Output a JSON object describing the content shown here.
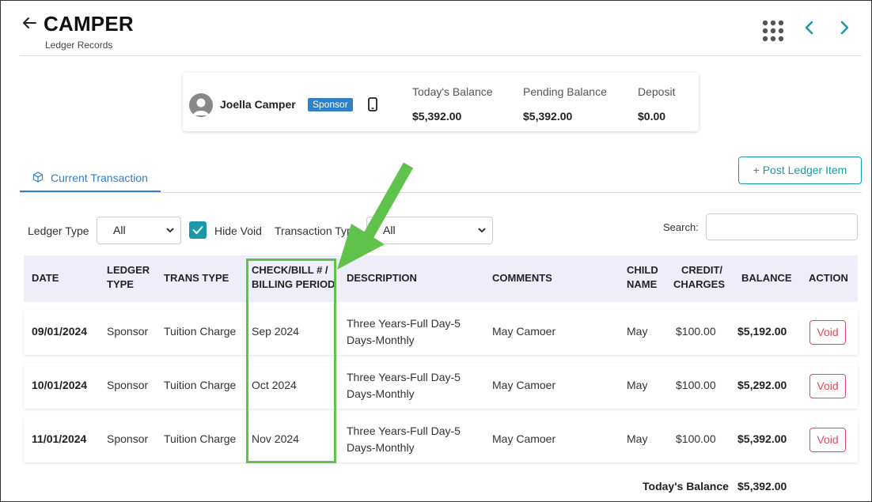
{
  "header": {
    "title": "CAMPER",
    "subtitle": "Ledger Records"
  },
  "summary": {
    "camper_name": "Joella Camper",
    "badge": "Sponsor",
    "todays_balance_label": "Today's Balance",
    "todays_balance_value": "$5,392.00",
    "pending_balance_label": "Pending Balance",
    "pending_balance_value": "$5,392.00",
    "deposit_label": "Deposit",
    "deposit_value": "$0.00"
  },
  "tabs": [
    {
      "label": "Current Transaction"
    }
  ],
  "post_button": "+ Post Ledger Item",
  "filters": {
    "ledger_type_label": "Ledger Type",
    "ledger_type_value": "All",
    "hide_void_label": "Hide Void",
    "hide_void_checked": true,
    "transaction_type_label": "Transaction Type",
    "transaction_type_value": "All",
    "search_label": "Search:",
    "search_value": ""
  },
  "table": {
    "columns": {
      "date": "DATE",
      "ledger_type_1": "LEDGER",
      "ledger_type_2": "TYPE",
      "trans_type": "TRANS TYPE",
      "check_1": "CHECK/BILL # /",
      "check_2": "BILLING PERIOD",
      "description": "DESCRIPTION",
      "comments": "COMMENTS",
      "child_1": "CHILD",
      "child_2": "NAME",
      "credit_1": "CREDIT/",
      "credit_2": "CHARGES",
      "balance": "BALANCE",
      "action": "ACTION"
    },
    "rows": [
      {
        "date": "09/01/2024",
        "ledger_type": "Sponsor",
        "trans_type": "Tuition Charge",
        "billing_period": "Sep 2024",
        "desc_1": "Three Years-Full Day-5",
        "desc_2": "Days-Monthly",
        "comments": "May Camoer",
        "child": "May",
        "charges": "$100.00",
        "balance": "$5,192.00",
        "action": "Void"
      },
      {
        "date": "10/01/2024",
        "ledger_type": "Sponsor",
        "trans_type": "Tuition Charge",
        "billing_period": "Oct 2024",
        "desc_1": "Three Years-Full Day-5",
        "desc_2": "Days-Monthly",
        "comments": "May Camoer",
        "child": "May",
        "charges": "$100.00",
        "balance": "$5,292.00",
        "action": "Void"
      },
      {
        "date": "11/01/2024",
        "ledger_type": "Sponsor",
        "trans_type": "Tuition Charge",
        "billing_period": "Nov 2024",
        "desc_1": "Three Years-Full Day-5",
        "desc_2": "Days-Monthly",
        "comments": "May Camoer",
        "child": "May",
        "charges": "$100.00",
        "balance": "$5,392.00",
        "action": "Void"
      }
    ],
    "footer_label": "Today's Balance",
    "footer_value": "$5,392.00"
  },
  "colors": {
    "accent_blue": "#2f80c9",
    "teal": "#1a9aa8",
    "void_red": "#e04a5e",
    "header_bg": "#eeeefb",
    "annotation_green": "#5fc24a"
  }
}
